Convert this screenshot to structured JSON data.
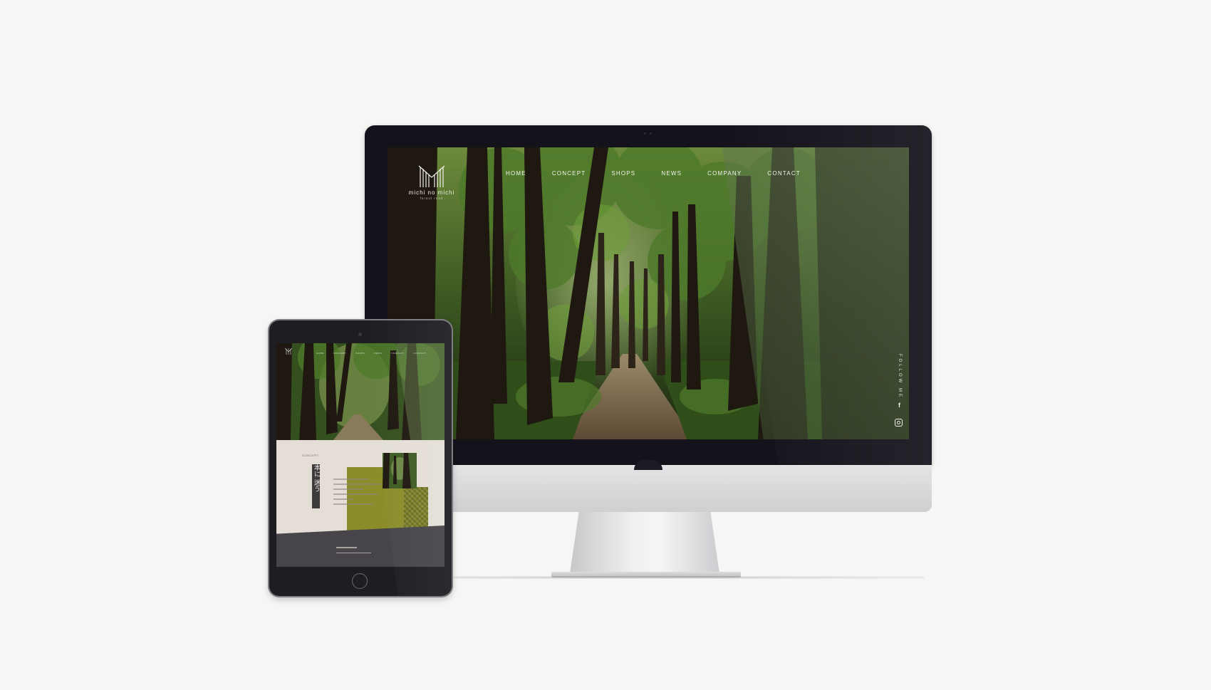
{
  "site": {
    "logo_text": "michi no michi",
    "logo_sub": "forest road"
  },
  "nav": {
    "items": [
      "HOME",
      "CONCEPT",
      "SHOPS",
      "NEWS",
      "COMPANY",
      "CONTACT"
    ]
  },
  "sidebar": {
    "follow_label": "FOLLOW ME",
    "facebook_icon": "facebook-icon",
    "instagram_icon": "instagram-icon"
  },
  "tablet": {
    "nav_items": [
      "HOME",
      "CONCEPT",
      "SHOPS",
      "NEWS",
      "COMPANY",
      "CONTACT"
    ],
    "concept_label": "CONCEPT",
    "concept_heading": "本に 迷う"
  },
  "colors": {
    "background": "#f6f6f4",
    "forest_dark": "#17200f",
    "olive": "#8a8d2a",
    "concept_bg": "#e4ded7",
    "charcoal": "#47444a"
  }
}
